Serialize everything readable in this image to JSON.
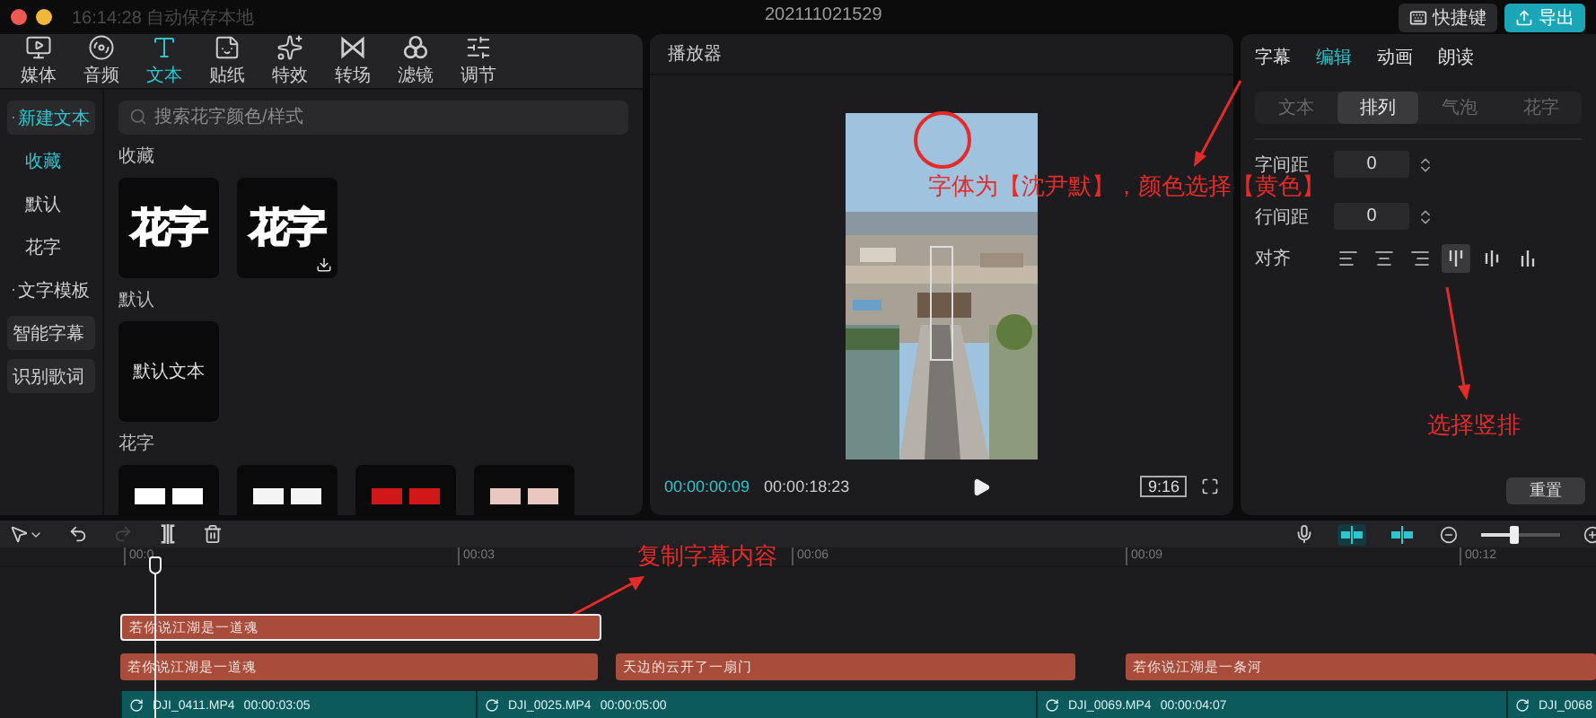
{
  "title_bar": {
    "autosave": "16:14:28 自动保存本地",
    "project": "202111021529",
    "buttons": [
      {
        "label": "快捷键",
        "kind": "plain"
      },
      {
        "label": "导出",
        "kind": "accent"
      }
    ]
  },
  "media_tabs": [
    {
      "label": "媒体",
      "selected": false
    },
    {
      "label": "音频",
      "selected": false
    },
    {
      "label": "文本",
      "selected": true
    },
    {
      "label": "贴纸",
      "selected": false
    },
    {
      "label": "特效",
      "selected": false
    },
    {
      "label": "转场",
      "selected": false
    },
    {
      "label": "滤镜",
      "selected": false
    },
    {
      "label": "调节",
      "selected": false
    }
  ],
  "sidebar": [
    {
      "label": "新建文本",
      "kind": "group",
      "selected": true
    },
    {
      "label": "收藏",
      "kind": "item",
      "selected": true
    },
    {
      "label": "默认",
      "kind": "item",
      "selected": false
    },
    {
      "label": "花字",
      "kind": "item",
      "selected": false
    },
    {
      "label": "文字模板",
      "kind": "group",
      "selected": false
    },
    {
      "label": "智能字幕",
      "kind": "button",
      "selected": false
    },
    {
      "label": "识别歌词",
      "kind": "button",
      "selected": false
    }
  ],
  "search": {
    "placeholder": "搜索花字颜色/样式"
  },
  "sections": [
    {
      "title": "收藏",
      "tiles": [
        {
          "kind": "fancy",
          "text": "花字",
          "download": false
        },
        {
          "kind": "fancy",
          "text": "花字",
          "download": true
        }
      ]
    },
    {
      "title": "默认",
      "tiles": [
        {
          "kind": "plain",
          "text": "默认文本"
        }
      ]
    },
    {
      "title": "花字",
      "tiles": [
        {
          "kind": "preview",
          "color": "#ffffff"
        },
        {
          "kind": "preview",
          "color": "#f4f4f4"
        },
        {
          "kind": "preview",
          "color": "#d01818"
        },
        {
          "kind": "preview",
          "color": "#e8c8c0"
        }
      ]
    }
  ],
  "player": {
    "title": "播放器",
    "current_time": "00:00:00:09",
    "total_time": "00:00:18:23",
    "ratio": "9:16"
  },
  "inspector": {
    "tabs": [
      {
        "label": "字幕",
        "selected": false
      },
      {
        "label": "编辑",
        "selected": true
      },
      {
        "label": "动画",
        "selected": false
      },
      {
        "label": "朗读",
        "selected": false
      }
    ],
    "subtabs": [
      {
        "label": "文本",
        "selected": false
      },
      {
        "label": "排列",
        "selected": true
      },
      {
        "label": "气泡",
        "selected": false
      },
      {
        "label": "花字",
        "selected": false
      }
    ],
    "fields": [
      {
        "label": "字间距",
        "value": "0"
      },
      {
        "label": "行间距",
        "value": "0"
      }
    ],
    "align_label": "对齐",
    "align_options": [
      {
        "kind": "h-left",
        "selected": false
      },
      {
        "kind": "h-center",
        "selected": false
      },
      {
        "kind": "h-right",
        "selected": false
      },
      {
        "kind": "v-top",
        "selected": true
      },
      {
        "kind": "v-center",
        "selected": false
      },
      {
        "kind": "v-bottom",
        "selected": false
      }
    ],
    "reset": "重置"
  },
  "timeline": {
    "ruler": [
      "00:0",
      "00:03",
      "00:06",
      "00:09",
      "00:12"
    ],
    "toggles": [
      {
        "on": true
      },
      {
        "on": true
      }
    ],
    "zoom": {
      "level": 0.4
    },
    "copy_track": [
      {
        "text": "若你说江湖是一道魂",
        "selected": true
      }
    ],
    "text_track": [
      {
        "text": "若你说江湖是一道魂",
        "selected": false
      },
      {
        "text": "天边的云开了一扇门",
        "selected": false
      },
      {
        "text": "若你说江湖是一条河",
        "selected": false
      }
    ],
    "video_track": [
      {
        "name": "DJI_0411.MP4",
        "duration": "00:00:03:05"
      },
      {
        "name": "DJI_0025.MP4",
        "duration": "00:00:05:00"
      },
      {
        "name": "DJI_0069.MP4",
        "duration": "00:00:04:07"
      },
      {
        "name": "DJI_0068"
      }
    ]
  },
  "annotations": [
    {
      "kind": "callout",
      "text": "字体为【沈尹默】，颜色选择【黄色】"
    },
    {
      "kind": "callout",
      "text": "选择竖排"
    },
    {
      "kind": "callout",
      "text": "复制字幕内容"
    }
  ]
}
